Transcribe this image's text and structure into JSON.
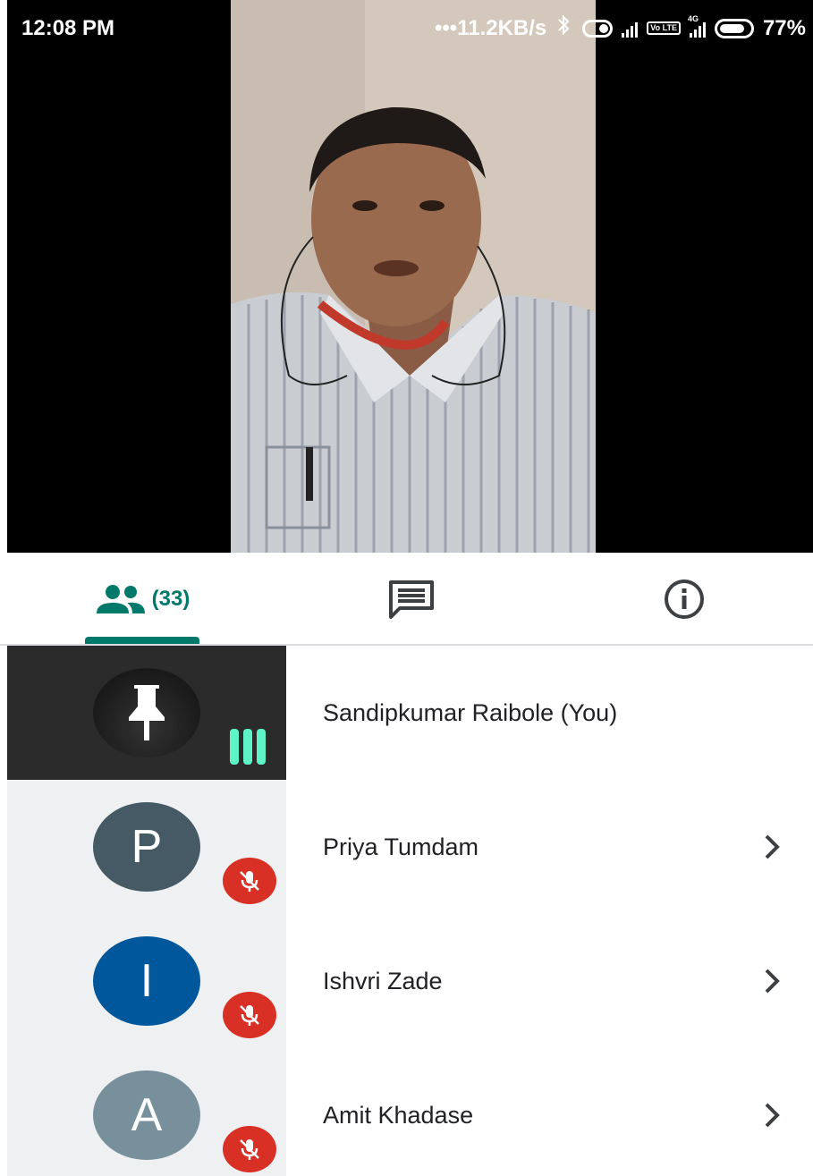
{
  "status_bar": {
    "time": "12:08 PM",
    "network_speed": "•••11.2KB/s",
    "battery": "77%",
    "icons": [
      "bluetooth-icon",
      "toggle-icon",
      "signal-icon",
      "volte-icon",
      "4g-signal-icon",
      "battery-icon"
    ],
    "volte_label": "Vo LTE",
    "network_type": "4G"
  },
  "video": {
    "icon": "camera-feed"
  },
  "tabs": {
    "people_count": "(33)",
    "people_icon": "people-icon",
    "chat_icon": "chat-icon",
    "info_icon": "info-icon",
    "active": "people"
  },
  "participants": [
    {
      "name": "Sandipkumar Raibole (You)",
      "avatar_icon": "pin-icon",
      "status": "speaking"
    },
    {
      "name": "Priya Tumdam",
      "avatar_letter": "P",
      "avatar_color": "#455a64",
      "status": "muted"
    },
    {
      "name": "Ishvri Zade",
      "avatar_letter": "I",
      "avatar_color": "#01579b",
      "status": "muted"
    },
    {
      "name": "Amit Khadase",
      "avatar_letter": "A",
      "avatar_color": "#78909c",
      "status": "muted"
    }
  ],
  "colors": {
    "accent": "#00796b",
    "muted_red": "#d93025",
    "speaking_green": "#5ef5c6"
  }
}
